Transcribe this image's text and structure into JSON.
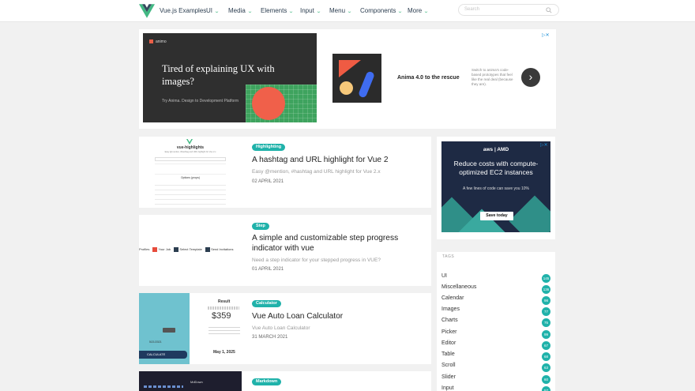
{
  "header": {
    "brand": "Vue.js Examples",
    "nav": [
      {
        "label": "UI"
      },
      {
        "label": "Media"
      },
      {
        "label": "Elements"
      },
      {
        "label": "Input"
      },
      {
        "label": "Menu"
      },
      {
        "label": "Components"
      },
      {
        "label": "More"
      }
    ],
    "search_placeholder": "Search"
  },
  "top_ad": {
    "brand": "animo",
    "title": "Tired of explaining UX with images?",
    "subtitle": "Try Anima. Design to Development Platform",
    "headline": "Anima 4.0 to the rescue",
    "blurb": "Switch to anima's code-based prototypes that feel like the real deal (because they are)."
  },
  "posts": [
    {
      "badge": "Highlighting",
      "title": "A hashtag and URL highlight for Vue 2",
      "desc": "Easy @mention, #hashtag and URL highlight for Vue 2.x",
      "date": "02 APRIL 2021",
      "thumb_title": "vue-highlights",
      "thumb_sub": "Easy @mention, #hashtag and URL highlight for Vue 2.x",
      "thumb_section": "Options (props)"
    },
    {
      "badge": "Step",
      "title": "A simple and customizable step progress indicator with vue",
      "desc": "Need a step indicator for your stepped progress in VUE?",
      "date": "01 APRIL 2021",
      "steps": [
        "Profiles",
        "Your Job",
        "Select Template",
        "Send Invitations"
      ]
    },
    {
      "badge": "Calculator",
      "title": "Vue Auto Loan Calculator",
      "desc": "Vue Auto Loan Calculator",
      "date": "31 MARCH 2021",
      "thumb_result": "Result",
      "thumb_amount": "$359",
      "thumb_button": "CALCULATE",
      "thumb_date": "May 1, 2025",
      "thumb_small_date": "5/21/2021"
    },
    {
      "badge": "Markdown",
      "thumb_title": "MdDown"
    }
  ],
  "side_ad": {
    "logo": "aws | AMD",
    "headline": "Reduce costs with compute-optimized EC2 instances",
    "sub": "A few lines of code can save you 10%",
    "button": "Save today"
  },
  "tags": {
    "heading": "TAGS",
    "items": [
      {
        "name": "UI",
        "count": "145"
      },
      {
        "name": "Miscellaneous",
        "count": "136"
      },
      {
        "name": "Calendar",
        "count": "98"
      },
      {
        "name": "Images",
        "count": "77"
      },
      {
        "name": "Charts",
        "count": "75"
      },
      {
        "name": "Picker",
        "count": "99"
      },
      {
        "name": "Editor",
        "count": "67"
      },
      {
        "name": "Table",
        "count": "68"
      },
      {
        "name": "Scroll",
        "count": "63"
      },
      {
        "name": "Slider",
        "count": "60"
      },
      {
        "name": "Input",
        "count": "57"
      }
    ]
  },
  "colors": {
    "accent": "#20b2aa",
    "vue_green": "#42b883"
  }
}
